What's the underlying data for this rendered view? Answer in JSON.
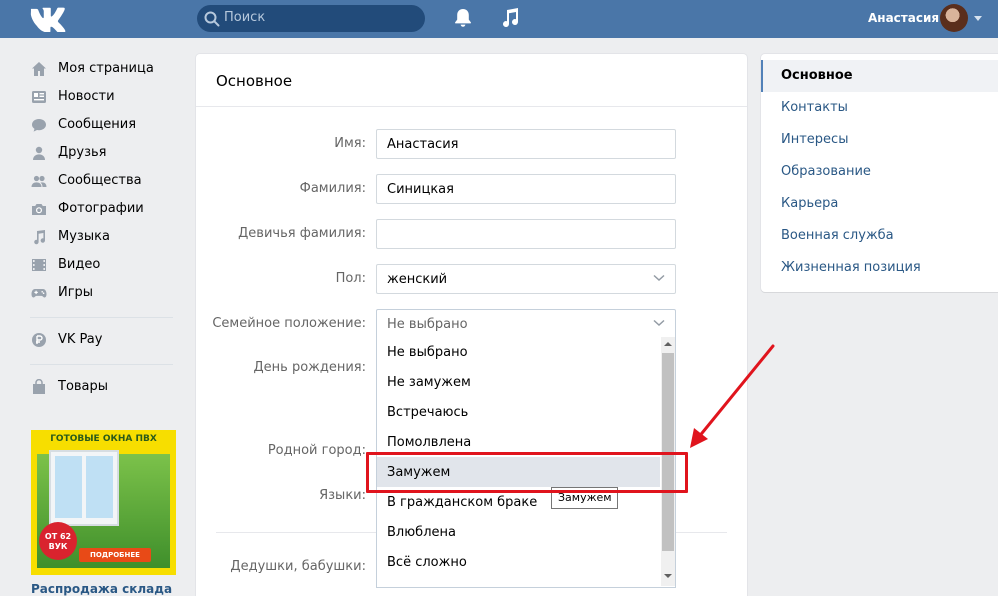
{
  "topbar": {
    "search_placeholder": "Поиск",
    "user_name": "Анастасия",
    "bg_color": "#4a76a8"
  },
  "leftnav": {
    "items": [
      {
        "label": "Моя страница",
        "icon": "home-icon"
      },
      {
        "label": "Новости",
        "icon": "news-icon"
      },
      {
        "label": "Сообщения",
        "icon": "chat-icon"
      },
      {
        "label": "Друзья",
        "icon": "person-icon"
      },
      {
        "label": "Сообщества",
        "icon": "group-icon"
      },
      {
        "label": "Фотографии",
        "icon": "camera-icon"
      },
      {
        "label": "Музыка",
        "icon": "music-icon"
      },
      {
        "label": "Видео",
        "icon": "film-icon"
      },
      {
        "label": "Игры",
        "icon": "gamepad-icon"
      }
    ],
    "pay_label": "VK Pay",
    "goods_label": "Товары"
  },
  "ad": {
    "title": "ГОТОВЫЕ ОКНА ПВХ",
    "badge_line1": "ОТ 62",
    "badge_line2": "ВУК",
    "button": "ПОДРОБНЕЕ",
    "caption": "Распродажа склада"
  },
  "form": {
    "title": "Основное",
    "name_label": "Имя:",
    "name_value": "Анастасия",
    "surname_label": "Фамилия:",
    "surname_value": "Синицкая",
    "maiden_label": "Девичья фамилия:",
    "maiden_value": "",
    "sex_label": "Пол:",
    "sex_value": "женский",
    "marital_label": "Семейное положение:",
    "marital_value": "Не выбрано",
    "birthday_label": "День рождения:",
    "hometown_label": "Родной город:",
    "languages_label": "Языки:",
    "grandparents_label": "Дедушки, бабушки:"
  },
  "dropdown": {
    "options": [
      "Не выбрано",
      "Не замужем",
      "Встречаюсь",
      "Помолвлена",
      "Замужем",
      "В гражданском браке",
      "Влюблена",
      "Всё сложно"
    ],
    "highlighted_index": 4,
    "tooltip": "Замужем"
  },
  "rightmenu": {
    "items": [
      "Основное",
      "Контакты",
      "Интересы",
      "Образование",
      "Карьера",
      "Военная служба",
      "Жизненная позиция"
    ],
    "active_index": 0
  },
  "annotation": {
    "color": "#e0141d"
  }
}
